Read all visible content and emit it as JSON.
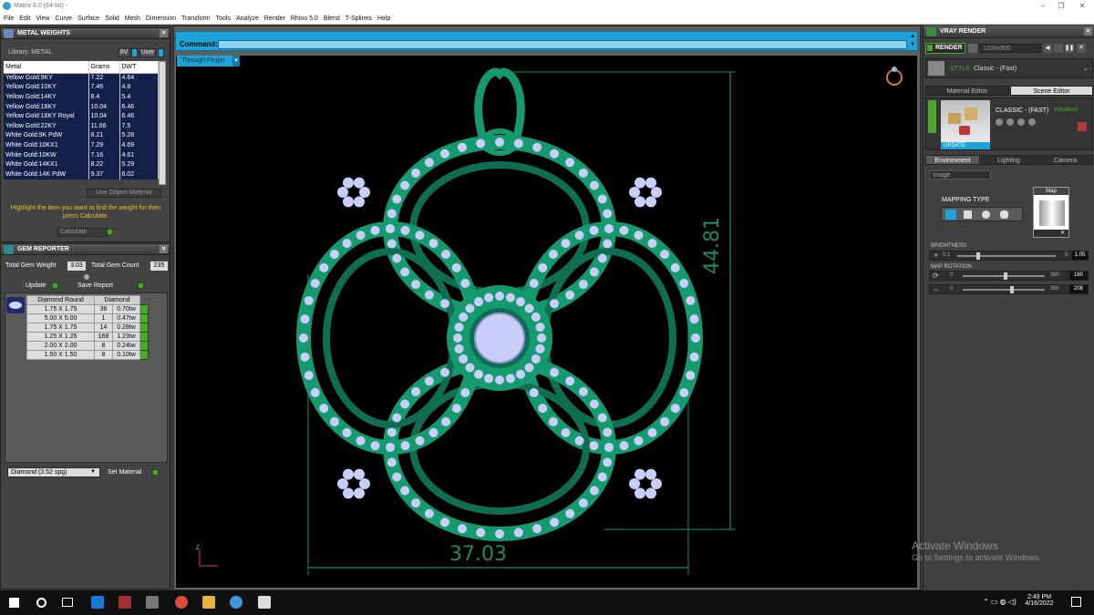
{
  "window": {
    "title": "Matrix 8.0 (64-bit) -",
    "controls": [
      "–",
      "❐",
      "✕"
    ]
  },
  "menu": [
    "File",
    "Edit",
    "View",
    "Curve",
    "Surface",
    "Solid",
    "Mesh",
    "Dimension",
    "Transform",
    "Tools",
    "Analyze",
    "Render",
    "Rhino 5.0",
    "Blend",
    "T-Splines",
    "Help"
  ],
  "metal_weights": {
    "title": "METAL WEIGHTS",
    "library_label": "Library: METAL",
    "toggle_a": "6V",
    "toggle_b": "User",
    "columns": [
      "Metal",
      "Grams",
      "DWT"
    ],
    "rows": [
      [
        "Yellow Gold:9KY",
        "7.22",
        "4.64"
      ],
      [
        "Yellow Gold:10KY",
        "7.46",
        "4.8"
      ],
      [
        "Yellow Gold:14KY",
        "8.4",
        "5.4"
      ],
      [
        "Yellow Gold:18KY",
        "10.04",
        "6.46"
      ],
      [
        "Yellow Gold:18KY Royal",
        "10.04",
        "6.46"
      ],
      [
        "Yellow Gold:22KY",
        "11.66",
        "7.5"
      ],
      [
        "White Gold:9K PdW",
        "8.21",
        "5.28"
      ],
      [
        "White Gold:10KX1",
        "7.29",
        "4.69"
      ],
      [
        "White Gold:10KW",
        "7.16",
        "4.61"
      ],
      [
        "White Gold:14KX1",
        "8.22",
        "5.29"
      ],
      [
        "White Gold:14K PdW",
        "9.37",
        "6.02"
      ]
    ],
    "use_object_material": "Use Object Material",
    "hint": "Highlight the item you want to find the weight for then press Calculate.",
    "calculate": "Calculate"
  },
  "gem_reporter": {
    "title": "GEM REPORTER",
    "total_weight_label": "Total Gem Weight",
    "total_weight": "3.03",
    "total_count_label": "Total Gem Count",
    "total_count": "235",
    "update": "Update",
    "save_report": "Save Report",
    "columns": [
      "Diamond Round",
      "Diamond"
    ],
    "rows": [
      [
        "1.75 X 1.75",
        "36",
        "0.70tw"
      ],
      [
        "5.00 X 5.00",
        "1",
        "0.47tw"
      ],
      [
        "1.75 X 1.75",
        "14",
        "0.28tw"
      ],
      [
        "1.25 X 1.25",
        "168",
        "1.23tw"
      ],
      [
        "2.00 X 2.00",
        "8",
        "0.24tw"
      ],
      [
        "1.50 X 1.50",
        "8",
        "0.10tw"
      ]
    ],
    "gem_select": "Diamond    (3.52 spg)",
    "set_material": "Set Material"
  },
  "command": {
    "label": "Command:",
    "value": ""
  },
  "viewport": {
    "mode": "Through Finger",
    "dim_height": "44.81",
    "dim_width": "37.03",
    "axis_z": "Z"
  },
  "vray": {
    "title": "VRAY RENDER",
    "render": "RENDER",
    "resolution": "1200x900",
    "style_label": "STYLE",
    "style_value": "Classic - (Fast)",
    "tabs": [
      "Material Editor",
      "Scene Editor"
    ],
    "preset": "CLASSIC - (FAST)",
    "modified": "(Modified)",
    "update": "UPDATE",
    "subtabs": [
      "Environment",
      "Lighting",
      "Camera"
    ],
    "env_select": "Image",
    "mapping_type": "MAPPING TYPE",
    "map_label": "Map",
    "brightness_label": "BRIGHTNESS",
    "brightness_min": "0.1",
    "brightness_max": "5",
    "brightness_value": "1.05",
    "map_rotation_label": "MAP ROTATION",
    "rot1_min": "0",
    "rot1_max": "360",
    "rot1_value": "180",
    "rot2_min": "0",
    "rot2_max": "360",
    "rot2_value": "208"
  },
  "watermark": {
    "line1": "Activate Windows",
    "line2": "Go to Settings to activate Windows."
  },
  "taskbar": {
    "time": "2:49 PM",
    "date": "4/16/2022"
  },
  "colors": {
    "accent": "#1ea3d9",
    "metal": "#159a70",
    "diamond": "#c9cef8",
    "dim": "#1f8a62",
    "green": "#4ca82c"
  }
}
